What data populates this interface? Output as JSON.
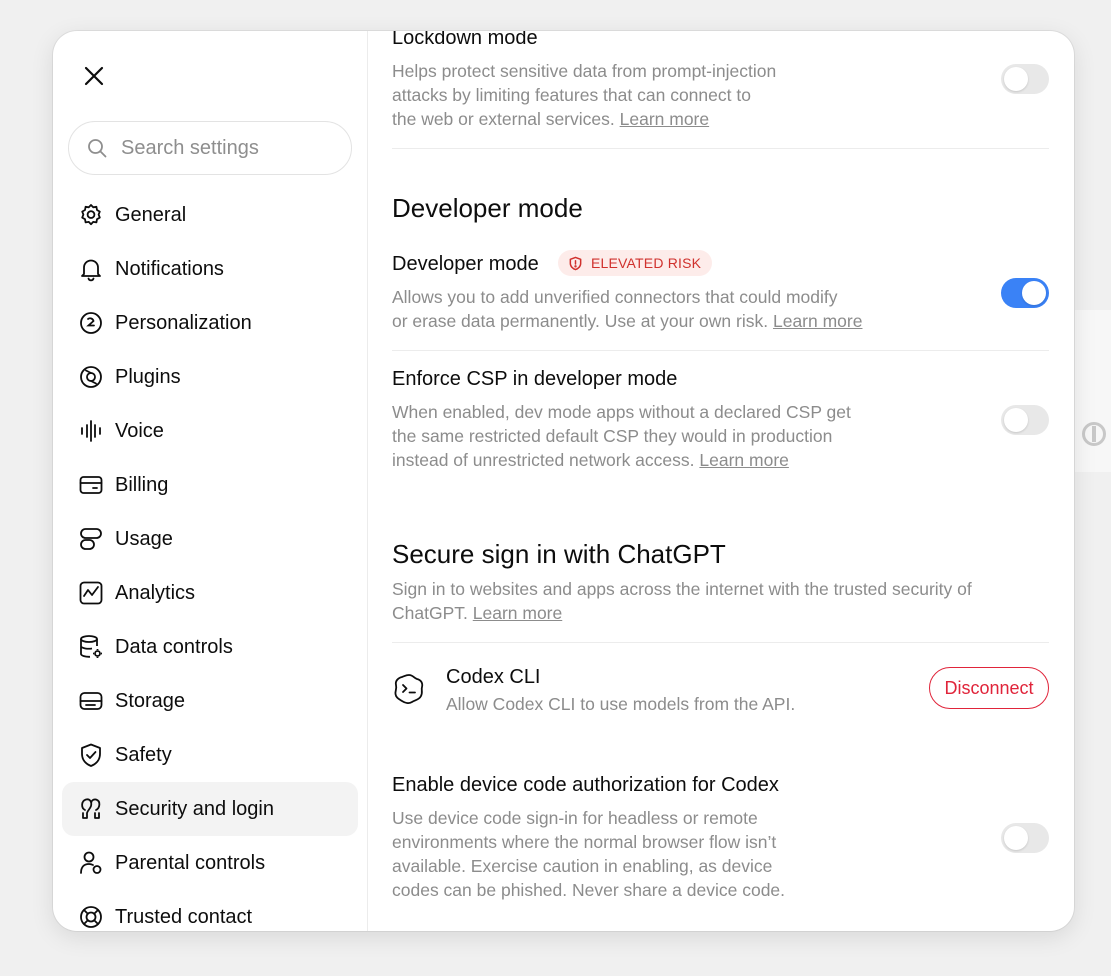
{
  "sidebar": {
    "search_placeholder": "Search settings",
    "items": [
      {
        "label": "General",
        "icon": "gear-icon"
      },
      {
        "label": "Notifications",
        "icon": "bell-icon"
      },
      {
        "label": "Personalization",
        "icon": "personalization-icon"
      },
      {
        "label": "Plugins",
        "icon": "plugins-icon"
      },
      {
        "label": "Voice",
        "icon": "waveform-icon"
      },
      {
        "label": "Billing",
        "icon": "credit-card-icon"
      },
      {
        "label": "Usage",
        "icon": "usage-icon"
      },
      {
        "label": "Analytics",
        "icon": "analytics-chart-icon"
      },
      {
        "label": "Data controls",
        "icon": "database-gear-icon"
      },
      {
        "label": "Storage",
        "icon": "storage-drive-icon"
      },
      {
        "label": "Safety",
        "icon": "shield-check-icon"
      },
      {
        "label": "Security and login",
        "icon": "security-people-icon",
        "active": true
      },
      {
        "label": "Parental controls",
        "icon": "parental-user-icon"
      },
      {
        "label": "Trusted contact",
        "icon": "lifebuoy-icon"
      }
    ]
  },
  "lockdown": {
    "title": "Lockdown mode",
    "desc_lines": [
      "Helps protect sensitive data from prompt-injection",
      "attacks by limiting features that can connect to",
      "the web or external services."
    ],
    "link": "Learn more",
    "enabled": false
  },
  "developer": {
    "section_title": "Developer mode",
    "mode_title": "Developer mode",
    "badge": "ELEVATED RISK",
    "mode_desc_lines": [
      "Allows you to add unverified connectors that could modify",
      "or erase data permanently. Use at your own risk."
    ],
    "mode_link": "Learn more",
    "mode_enabled": true,
    "csp_title": "Enforce CSP in developer mode",
    "csp_desc_lines": [
      "When enabled, dev mode apps without a declared CSP get",
      "the same restricted default CSP they would in production",
      "instead of unrestricted network access."
    ],
    "csp_link": "Learn more",
    "csp_enabled": false
  },
  "secure_signin": {
    "section_title": "Secure sign in with ChatGPT",
    "desc_lines": [
      "Sign in to websites and apps across the internet with the trusted security of",
      "ChatGPT."
    ],
    "link": "Learn more",
    "app_name": "Codex CLI",
    "app_desc": "Allow Codex CLI to use models from the API.",
    "disconnect_label": "Disconnect"
  },
  "device_code": {
    "title": "Enable device code authorization for Codex",
    "desc_lines": [
      "Use device code sign-in for headless or remote",
      "environments where the normal browser flow isn’t",
      "available. Exercise caution in enabling, as device",
      "codes can be phished. Never share a device code."
    ],
    "enabled": false
  },
  "colors": {
    "toggle_on": "#3a82f6",
    "danger": "#e0243a",
    "badge_bg": "#fdecea"
  }
}
